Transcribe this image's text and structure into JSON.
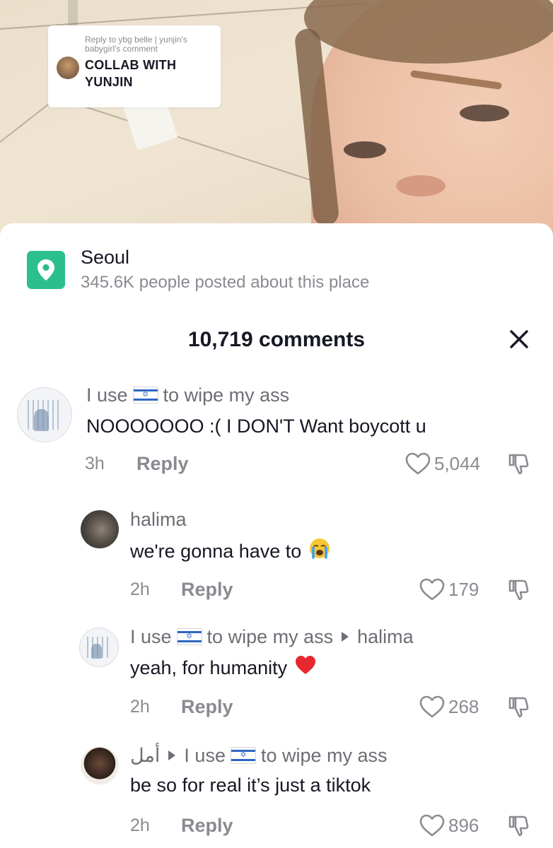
{
  "video": {
    "reply_card": {
      "meta": "Reply to ybg belle | yunjin's babygirl's comment",
      "text": "COLLAB WITH YUNJIN"
    }
  },
  "location": {
    "name": "Seoul",
    "subtitle": "345.6K people posted about this place",
    "icon": "location-pin-icon",
    "accent": "#2bbf8e"
  },
  "header": {
    "count_label": "10,719 comments",
    "close_icon": "close-icon"
  },
  "comments": [
    {
      "user_prefix": "I use",
      "user_suffix": "to wipe my ass",
      "text": "NOOOOOOO :( I DON'T Want boycott u",
      "time": "3h",
      "reply_label": "Reply",
      "likes": "5,044"
    },
    {
      "user": "halima",
      "text": "we're gonna have to",
      "time": "2h",
      "reply_label": "Reply",
      "likes": "179"
    },
    {
      "user_prefix": "I use",
      "user_suffix": "to wipe my ass",
      "reply_to": "halima",
      "text": "yeah, for humanity",
      "time": "2h",
      "reply_label": "Reply",
      "likes": "268"
    },
    {
      "user": "أمل",
      "reply_to_prefix": "I use",
      "reply_to_suffix": "to wipe my ass",
      "text": "be so for real it’s just a tiktok",
      "time": "2h",
      "reply_label": "Reply",
      "likes": "896"
    }
  ]
}
